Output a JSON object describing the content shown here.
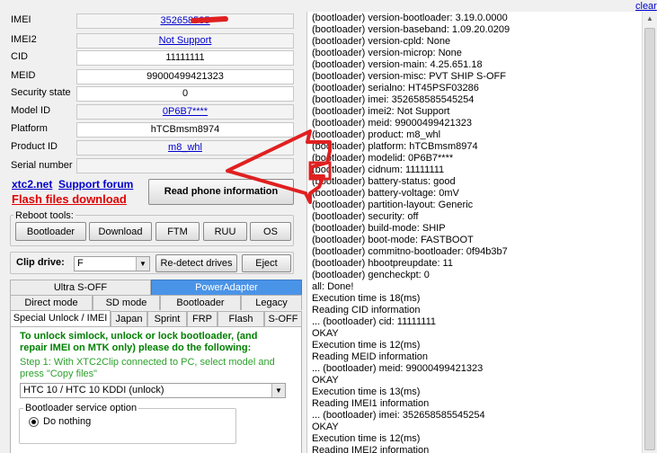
{
  "clear_link": "clear",
  "info": {
    "imei": {
      "label": "IMEI",
      "value": "352658585"
    },
    "imei2": {
      "label": "IMEI2",
      "value": "Not Support"
    },
    "cid": {
      "label": "CID",
      "value": "11111111"
    },
    "meid": {
      "label": "MEID",
      "value": "99000499421323"
    },
    "security": {
      "label": "Security state",
      "value": "0"
    },
    "model": {
      "label": "Model ID",
      "value": "0P6B7****"
    },
    "platform": {
      "label": "Platform",
      "value": "hTCBmsm8974"
    },
    "product": {
      "label": "Product ID",
      "value": "m8_whl"
    },
    "serial": {
      "label": "Serial number",
      "value": ""
    }
  },
  "links": {
    "site": "xtc2.net",
    "forum": "Support forum",
    "flash": "Flash files download"
  },
  "read_button": "Read phone information",
  "reboot": {
    "title": "Reboot tools:",
    "buttons": [
      "Bootloader",
      "Download",
      "FTM",
      "RUU",
      "OS"
    ]
  },
  "clip": {
    "label": "Clip drive:",
    "value": "F",
    "redetect": "Re-detect drives",
    "eject": "Eject"
  },
  "tabs_row1": [
    "Ultra S-OFF",
    "PowerAdapter"
  ],
  "tabs_row2": [
    "Direct mode",
    "SD mode",
    "Bootloader",
    "Legacy"
  ],
  "tabs_row3": [
    "Special Unlock / IMEI",
    "Japan",
    "Sprint",
    "FRP",
    "Flash",
    "S-OFF"
  ],
  "panel": {
    "instructions": "To unlock simlock, unlock or lock bootloader, (and repair IMEI on MTK only) please do the following:",
    "step1": "Step 1: With XTC2Clip connected to PC, select model and press \"Copy files\"",
    "model_select": "HTC 10 / HTC 10 KDDI (unlock)",
    "service_title": "Bootloader service option",
    "radio_label": "Do nothing"
  },
  "log": [
    "(bootloader) version-bootloader: 3.19.0.0000",
    "(bootloader) version-baseband: 1.09.20.0209",
    "(bootloader) version-cpld: None",
    "(bootloader) version-microp: None",
    "(bootloader) version-main: 4.25.651.18",
    "(bootloader) version-misc: PVT SHIP S-OFF",
    "(bootloader) serialno: HT45PSF03286",
    "(bootloader) imei: 352658585545254",
    "(bootloader) imei2: Not Support",
    "(bootloader) meid: 99000499421323",
    "(bootloader) product: m8_whl",
    "(bootloader) platform: hTCBmsm8974",
    "(bootloader) modelid: 0P6B7****",
    "(bootloader) cidnum: 11111111",
    "(bootloader) battery-status: good",
    "(bootloader) battery-voltage: 0mV",
    "(bootloader) partition-layout: Generic",
    "(bootloader) security: off",
    "(bootloader) build-mode: SHIP",
    "(bootloader) boot-mode: FASTBOOT",
    "(bootloader) commitno-bootloader: 0f94b3b7",
    "(bootloader) hbootpreupdate: 11",
    "(bootloader) gencheckpt: 0",
    "all: Done!",
    "Execution time is 18(ms)",
    "Reading CID information",
    "... (bootloader) cid: 11111111",
    "OKAY",
    "Execution time is 12(ms)",
    "Reading MEID information",
    "... (bootloader) meid: 99000499421323",
    "OKAY",
    "Execution time is 13(ms)",
    "Reading IMEI1 information",
    "... (bootloader) imei: 352658585545254",
    "OKAY",
    "Execution time is 12(ms)",
    "Reading IMEI2 information"
  ],
  "colors": {
    "accent_blue": "#4a94e8",
    "red_link": "#e00000",
    "annotation_red": "#e02020",
    "instruction_green": "#008000",
    "step_green": "#2ca02c"
  }
}
